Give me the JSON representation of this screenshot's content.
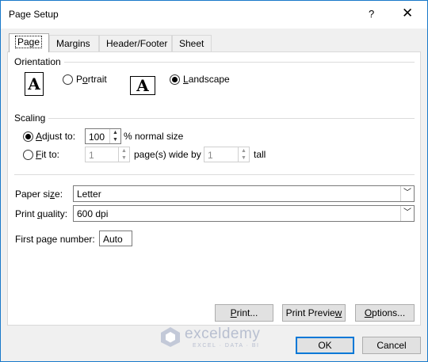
{
  "window": {
    "title": "Page Setup",
    "help_glyph": "?",
    "close_glyph": "✕"
  },
  "tabs": [
    {
      "label": "Page",
      "active": true
    },
    {
      "label": "Margins",
      "active": false
    },
    {
      "label": "Header/Footer",
      "active": false
    },
    {
      "label": "Sheet",
      "active": false
    }
  ],
  "orientation": {
    "heading": "Orientation",
    "icon_glyph": "A",
    "portrait": {
      "pre": "P",
      "accel": "o",
      "post": "rtrait",
      "checked": false
    },
    "landscape": {
      "pre": "",
      "accel": "L",
      "post": "andscape",
      "checked": true
    }
  },
  "scaling": {
    "heading": "Scaling",
    "adjust": {
      "pre": "",
      "accel": "A",
      "post": "djust to:",
      "checked": true,
      "value": "100",
      "suffix": "% normal size"
    },
    "fit": {
      "pre": "",
      "accel": "F",
      "post": "it to:",
      "checked": false,
      "wide_value": "1",
      "wide_suffix": "page(s) wide by",
      "tall_value": "1",
      "tall_suffix": "tall"
    }
  },
  "paper_size": {
    "pre": "Paper si",
    "accel": "z",
    "post": "e:",
    "value": "Letter"
  },
  "print_quality": {
    "pre": "Print ",
    "accel": "q",
    "post": "uality:",
    "value": "600 dpi"
  },
  "first_page": {
    "label": "First page number:",
    "value": "Auto"
  },
  "buttons": {
    "print": {
      "pre": "",
      "accel": "P",
      "post": "rint..."
    },
    "preview": {
      "pre": "Print Previe",
      "accel": "w",
      "post": ""
    },
    "options": {
      "pre": "",
      "accel": "O",
      "post": "ptions..."
    },
    "ok": "OK",
    "cancel": "Cancel"
  },
  "watermark": {
    "brand": "exceldemy",
    "tagline": "EXCEL · DATA · BI"
  },
  "colors": {
    "accent": "#0078d7",
    "border": "#1979ca"
  }
}
